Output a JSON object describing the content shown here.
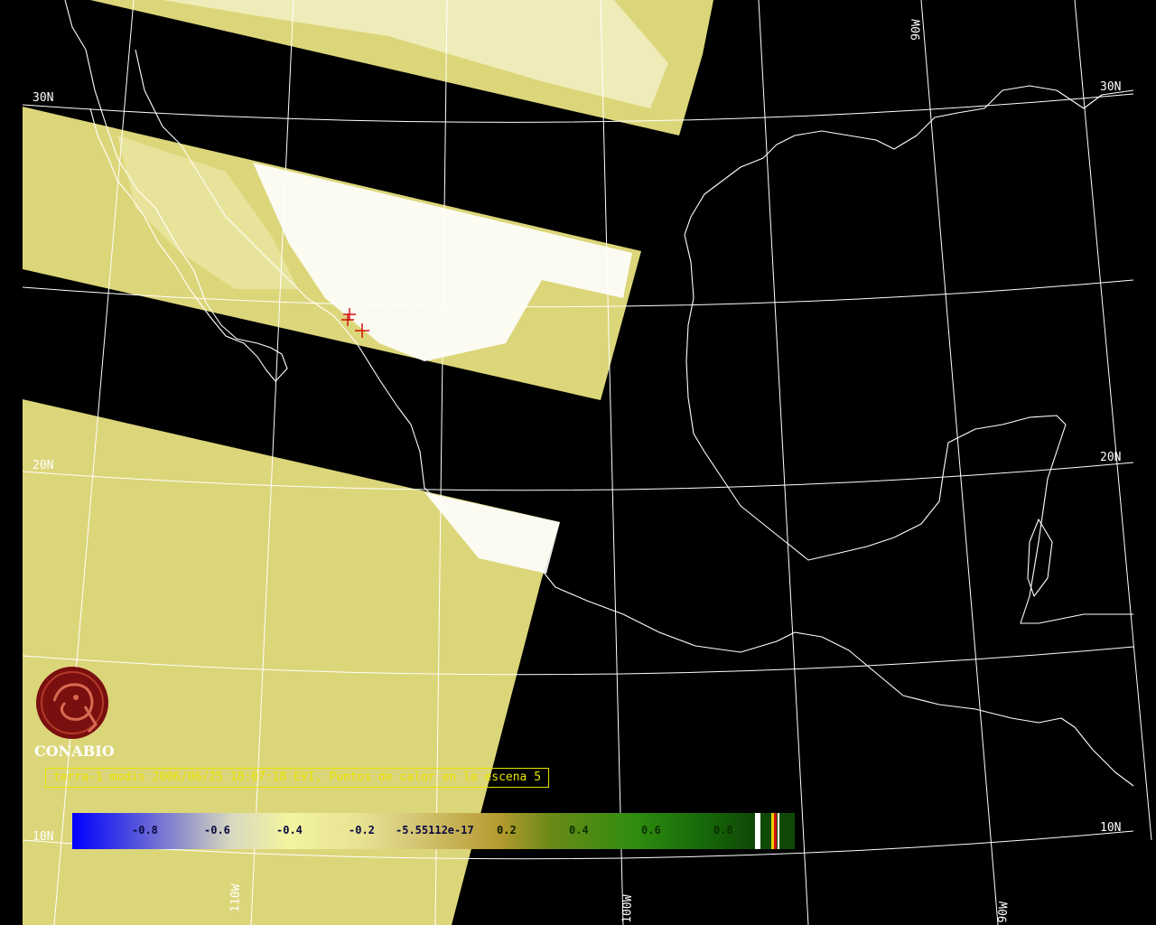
{
  "caption": "terra-1 modis 2006/06/25 18:07:18 EVI, Puntos de calor en la escena 5",
  "logo": {
    "text": "CONABIO"
  },
  "latitude_labels": [
    "30N",
    "20N",
    "10N"
  ],
  "longitude_labels": [
    "110W",
    "100W",
    "90W"
  ],
  "colorbar": {
    "ticks": [
      "-0.8",
      "-0.6",
      "-0.4",
      "-0.2",
      "-5.55112e-17",
      "0.2",
      "0.4",
      "0.6",
      "0.8"
    ],
    "range": [
      -1.0,
      1.0
    ],
    "colors": {
      "low": "#0000ff",
      "mid": "#e6e292",
      "high": "#0e4a06"
    }
  },
  "colors": {
    "background": "#000000",
    "swath": "#dcd67a",
    "cloud": "#ffffff",
    "grid": "#ffffff",
    "coast": "#ffffff",
    "caption": "#e8e300",
    "fire": "#d21010",
    "logo": "#7a0f0f"
  }
}
